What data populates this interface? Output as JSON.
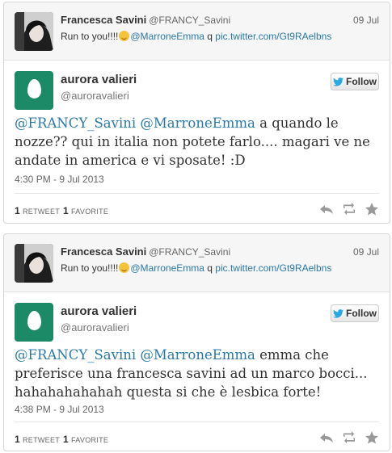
{
  "tweets": [
    {
      "parent": {
        "name": "Francesca Savini",
        "handle": "@FRANCY_Savini",
        "date": "09 Jul",
        "text_before": "Run to you!!!!",
        "mention": "@MarroneEmma",
        "text_mid": " q ",
        "link": "pic.twitter.com/Gt9RAelbns"
      },
      "author": {
        "name": "aurora valieri",
        "handle": "@auroravalieri"
      },
      "follow_label": "Follow",
      "text": {
        "mention1": "@FRANCY_Savini",
        "mention2": "@MarroneEmma",
        "body": " a quando le nozze?? qui in italia non potete farlo.... magari ve ne andate in america e vi sposate! :D"
      },
      "timestamp": "4:30 PM - 9 Jul 2013",
      "retweets": {
        "count": "1",
        "label": "RETWEET"
      },
      "favorites": {
        "count": "1",
        "label": "FAVORITE"
      }
    },
    {
      "parent": {
        "name": "Francesca Savini",
        "handle": "@FRANCY_Savini",
        "date": "09 Jul",
        "text_before": "Run to you!!!!",
        "mention": "@MarroneEmma",
        "text_mid": " q ",
        "link": "pic.twitter.com/Gt9RAelbns"
      },
      "author": {
        "name": "aurora valieri",
        "handle": "@auroravalieri"
      },
      "follow_label": "Follow",
      "text": {
        "mention1": "@FRANCY_Savini",
        "mention2": "@MarroneEmma",
        "body": "  emma che preferisce una francesca savini ad un marco bocci... hahahahahahah questa si che è lesbica forte!"
      },
      "timestamp": "4:38 PM - 9 Jul 2013",
      "retweets": {
        "count": "1",
        "label": "RETWEET"
      },
      "favorites": {
        "count": "1",
        "label": "FAVORITE"
      }
    }
  ],
  "colors": {
    "link": "#2a7aa8",
    "egg_avatar_bg": "#1c8a67",
    "twitter_bird": "#2aa9e0"
  },
  "icons": [
    "twitter-bird-icon",
    "reply-icon",
    "retweet-icon",
    "favorite-star-icon",
    "smiley-emoji-icon"
  ]
}
